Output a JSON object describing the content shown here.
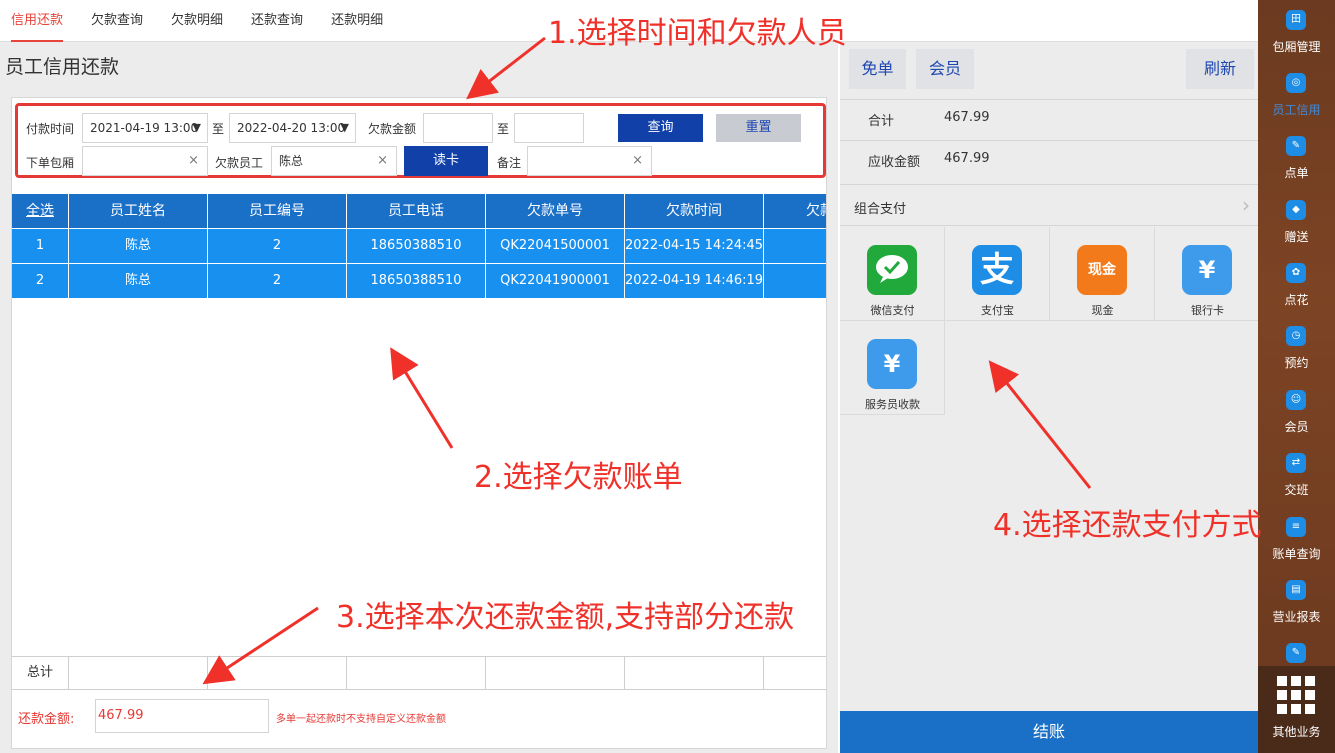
{
  "top_tabs": [
    {
      "label": "信用还款",
      "active": true
    },
    {
      "label": "欠款查询"
    },
    {
      "label": "欠款明细"
    },
    {
      "label": "还款查询"
    },
    {
      "label": "还款明细"
    }
  ],
  "page_title": "员工信用还款",
  "filter": {
    "pay_time_label": "付款时间",
    "date_from": "2021-04-19 13:00",
    "to_label": "至",
    "date_to": "2022-04-20 13:00",
    "debt_amount_label": "欠款金额",
    "debt_amount_min": "",
    "debt_amount_max": "",
    "query_button": "查询",
    "reset_button": "重置",
    "room_label": "下单包厢",
    "room_value": "",
    "staff_label": "欠款员工",
    "staff_value": "陈总",
    "read_card_button": "读卡",
    "remark_label": "备注",
    "remark_value": "",
    "clear_glyph": "×",
    "dropdown_glyph": "▼"
  },
  "table": {
    "headers": [
      "全选",
      "员工姓名",
      "员工编号",
      "员工电话",
      "欠款单号",
      "欠款时间",
      "欠款"
    ],
    "rows": [
      [
        "1",
        "陈总",
        "2",
        "18650388510",
        "QK22041500001",
        "2022-04-15 14:24:45",
        ""
      ],
      [
        "2",
        "陈总",
        "2",
        "18650388510",
        "QK22041900001",
        "2022-04-19 14:46:19",
        ""
      ]
    ],
    "total_label": "总计"
  },
  "repay": {
    "label": "还款金额:",
    "amount": "467.99",
    "note": "多单一起还款时不支持自定义还款金额"
  },
  "right": {
    "free_button": "免单",
    "member_button": "会员",
    "refresh_button": "刷新",
    "total_label": "合计",
    "total_value": "467.99",
    "receivable_label": "应收金额",
    "receivable_value": "467.99",
    "combo_label": "组合支付",
    "payments": [
      {
        "name": "微信支付",
        "icon": "wechat-pay-icon",
        "glyph": "✓",
        "color": "#22a93c"
      },
      {
        "name": "支付宝",
        "icon": "alipay-icon",
        "glyph": "支",
        "color": "#1d8de6"
      },
      {
        "name": "现金",
        "icon": "cash-icon",
        "glyph": "现金",
        "color": "#f27a1a"
      },
      {
        "name": "银行卡",
        "icon": "bank-card-icon",
        "glyph": "¥",
        "color": "#3e9bec"
      },
      {
        "name": "服务员收款",
        "icon": "waiter-collect-icon",
        "glyph": "¥",
        "color": "#3e9bec"
      }
    ],
    "checkout_button": "结账"
  },
  "sidebar": [
    {
      "label": "包厢管理",
      "icon": "room-manage-icon",
      "glyph": "田"
    },
    {
      "label": "员工信用",
      "icon": "staff-credit-icon",
      "glyph": "◎",
      "active": true
    },
    {
      "label": "点单",
      "icon": "order-icon",
      "glyph": "✎"
    },
    {
      "label": "赠送",
      "icon": "gift-icon",
      "glyph": "◆"
    },
    {
      "label": "点花",
      "icon": "flower-icon",
      "glyph": "✿"
    },
    {
      "label": "预约",
      "icon": "reserve-icon",
      "glyph": "◷"
    },
    {
      "label": "会员",
      "icon": "member-icon",
      "glyph": "☺"
    },
    {
      "label": "交班",
      "icon": "handover-icon",
      "glyph": "⇄"
    },
    {
      "label": "账单查询",
      "icon": "bill-query-icon",
      "glyph": "≡"
    },
    {
      "label": "营业报表",
      "icon": "report-icon",
      "glyph": "▤"
    }
  ],
  "other_business": "其他业务",
  "annotations": {
    "step1": "1.选择时间和欠款人员",
    "step2": "2.选择欠款账单",
    "step3": "3.选择本次还款金额,支持部分还款",
    "step4": "4.选择还款支付方式"
  },
  "colors": {
    "accent_red": "#e53935",
    "table_blue": "#1a6fc7",
    "row_blue": "#1890f0",
    "button_navy": "#1040a8",
    "sidebar_brown": "#6b3a20"
  }
}
